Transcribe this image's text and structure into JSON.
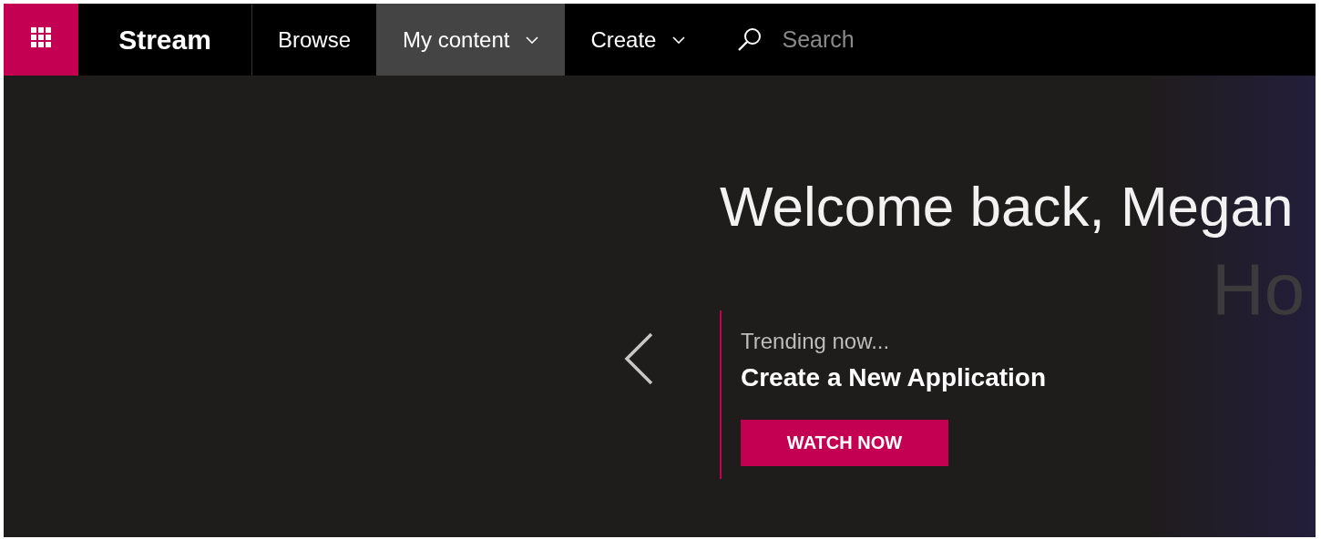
{
  "brand": "Stream",
  "nav": [
    {
      "label": "Browse",
      "selected": false,
      "dropdown": false
    },
    {
      "label": "My content",
      "selected": true,
      "dropdown": true
    },
    {
      "label": "Create",
      "selected": false,
      "dropdown": true
    }
  ],
  "search": {
    "placeholder": "Search"
  },
  "hero": {
    "title": "Welcome back, Megan",
    "background_word": "Ho",
    "eyebrow": "Trending now...",
    "feature_title": "Create a New Application",
    "button": "WATCH NOW"
  }
}
